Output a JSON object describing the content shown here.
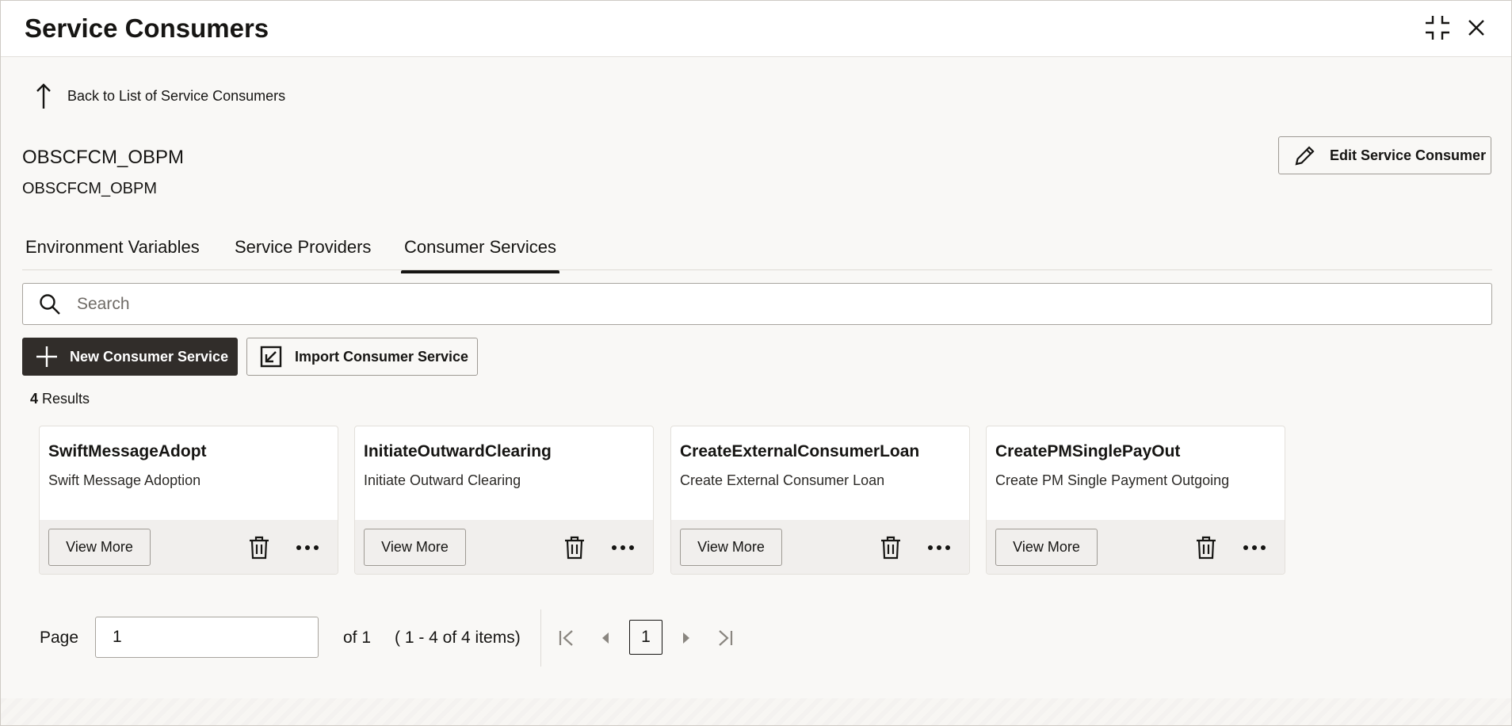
{
  "window": {
    "title": "Service Consumers",
    "minimize_icon": "collapse-icon",
    "close_icon": "close-icon"
  },
  "back_link": {
    "label": "Back to List of Service Consumers",
    "icon": "arrow-up-icon"
  },
  "consumer": {
    "name": "OBSCFCM_OBPM",
    "description": "OBSCFCM_OBPM"
  },
  "edit_button": {
    "label": "Edit Service Consumer",
    "icon": "pencil-icon"
  },
  "tabs": [
    {
      "label": "Environment Variables",
      "active": false
    },
    {
      "label": "Service Providers",
      "active": false
    },
    {
      "label": "Consumer Services",
      "active": true
    }
  ],
  "search": {
    "placeholder": "Search",
    "value": ""
  },
  "toolbar": {
    "new_label": "New Consumer Service",
    "import_label": "Import Consumer Service"
  },
  "results": {
    "count": "4",
    "label": "Results"
  },
  "cards": [
    {
      "name": "SwiftMessageAdopt",
      "description": "Swift Message Adoption",
      "view_more": "View More"
    },
    {
      "name": "InitiateOutwardClearing",
      "description": "Initiate Outward Clearing",
      "view_more": "View More"
    },
    {
      "name": "CreateExternalConsumerLoan",
      "description": "Create External Consumer Loan",
      "view_more": "View More"
    },
    {
      "name": "CreatePMSinglePayOut",
      "description": "Create PM Single Payment Outgoing",
      "view_more": "View More"
    }
  ],
  "pagination": {
    "page_label": "Page",
    "page_value": "1",
    "of_label": "of 1",
    "range_label": "( 1 - 4 of 4 items)",
    "current_page": "1"
  },
  "colors": {
    "primary_button": "#312d2a",
    "background": "#f9f8f6",
    "text": "#161513"
  }
}
